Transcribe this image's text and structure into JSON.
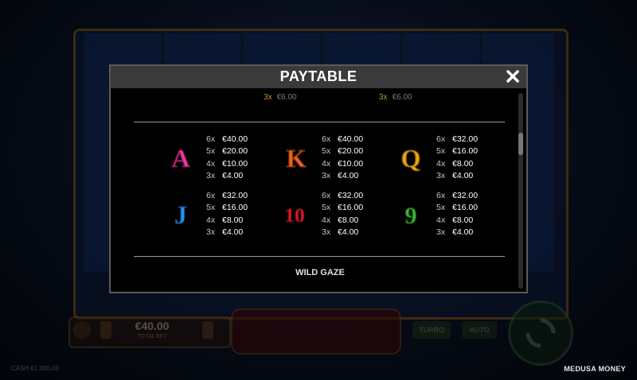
{
  "game": {
    "brand": "MEDUSA MONEY",
    "total_bet_value": "€40.00",
    "total_bet_label": "TOTAL BET",
    "turbo_label": "TURBO",
    "auto_label": "AUTO",
    "bottom_info": "CASH €1,000.00"
  },
  "modal": {
    "title": "PAYTABLE",
    "partial_rows": [
      {
        "mult": "3x",
        "amount": "€6.00"
      },
      {
        "mult": "3x",
        "amount": "€6.00"
      }
    ],
    "symbols": [
      {
        "symbol": "A",
        "color": "#e0409a",
        "payouts": [
          {
            "m": "6x",
            "v": "€40.00"
          },
          {
            "m": "5x",
            "v": "€20.00"
          },
          {
            "m": "4x",
            "v": "€10.00"
          },
          {
            "m": "3x",
            "v": "€4.00"
          }
        ]
      },
      {
        "symbol": "K",
        "color": "#e8641c",
        "payouts": [
          {
            "m": "6x",
            "v": "€40.00"
          },
          {
            "m": "5x",
            "v": "€20.00"
          },
          {
            "m": "4x",
            "v": "€10.00"
          },
          {
            "m": "3x",
            "v": "€4.00"
          }
        ]
      },
      {
        "symbol": "Q",
        "color": "#e8a617",
        "payouts": [
          {
            "m": "6x",
            "v": "€32.00"
          },
          {
            "m": "5x",
            "v": "€16.00"
          },
          {
            "m": "4x",
            "v": "€8.00"
          },
          {
            "m": "3x",
            "v": "€4.00"
          }
        ]
      },
      {
        "symbol": "J",
        "color": "#2f8fe6",
        "payouts": [
          {
            "m": "6x",
            "v": "€32.00"
          },
          {
            "m": "5x",
            "v": "€16.00"
          },
          {
            "m": "4x",
            "v": "€8.00"
          },
          {
            "m": "3x",
            "v": "€4.00"
          }
        ]
      },
      {
        "symbol": "10",
        "color": "#d81e2a",
        "payouts": [
          {
            "m": "6x",
            "v": "€32.00"
          },
          {
            "m": "5x",
            "v": "€16.00"
          },
          {
            "m": "4x",
            "v": "€8.00"
          },
          {
            "m": "3x",
            "v": "€4.00"
          }
        ]
      },
      {
        "symbol": "9",
        "color": "#3cb83a",
        "payouts": [
          {
            "m": "6x",
            "v": "€32.00"
          },
          {
            "m": "5x",
            "v": "€16.00"
          },
          {
            "m": "4x",
            "v": "€8.00"
          },
          {
            "m": "3x",
            "v": "€4.00"
          }
        ]
      }
    ],
    "next_section": "WILD GAZE",
    "close_icon": "close-icon"
  }
}
